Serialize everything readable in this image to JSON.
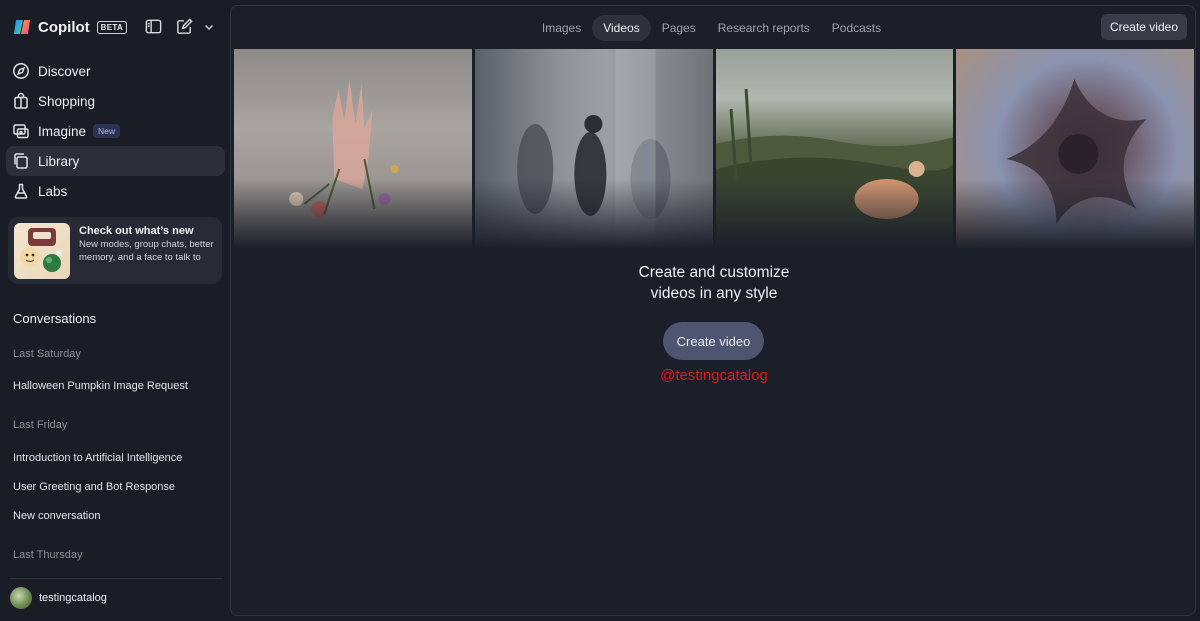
{
  "app": {
    "name": "Copilot",
    "badge": "BETA"
  },
  "nav": [
    {
      "label": "Discover",
      "icon": "compass-icon",
      "active": false
    },
    {
      "label": "Shopping",
      "icon": "shopping-bag-icon",
      "active": false
    },
    {
      "label": "Imagine",
      "icon": "image-icon",
      "badge": "New",
      "active": false
    },
    {
      "label": "Library",
      "icon": "library-icon",
      "active": true
    },
    {
      "label": "Labs",
      "icon": "flask-icon",
      "active": false
    }
  ],
  "promo": {
    "title": "Check out what’s new",
    "body": "New modes, group chats, better memory, and a face to talk to"
  },
  "conversations": {
    "header": "Conversations",
    "groups": [
      {
        "label": "Last Saturday",
        "items": [
          "Halloween Pumpkin Image Request"
        ]
      },
      {
        "label": "Last Friday",
        "items": [
          "Introduction to Artificial Intelligence",
          "User Greeting and Bot Response",
          "New conversation"
        ]
      },
      {
        "label": "Last Thursday",
        "items": []
      }
    ]
  },
  "user": {
    "name": "testingcatalog"
  },
  "tabs": [
    {
      "label": "Images",
      "active": false
    },
    {
      "label": "Videos",
      "active": true
    },
    {
      "label": "Pages",
      "active": false
    },
    {
      "label": "Research reports",
      "active": false
    },
    {
      "label": "Podcasts",
      "active": false
    }
  ],
  "header_button": "Create video",
  "empty_state": {
    "title_line1": "Create and customize",
    "title_line2": "videos in any style",
    "button": "Create video"
  },
  "watermark": "@testingcatalog",
  "colors": {
    "background": "#1a1d25",
    "panel": "#1b1f29",
    "active_nav": "#2b2f3a",
    "cta_button": "#4e5570",
    "watermark": "#e01b1b"
  }
}
